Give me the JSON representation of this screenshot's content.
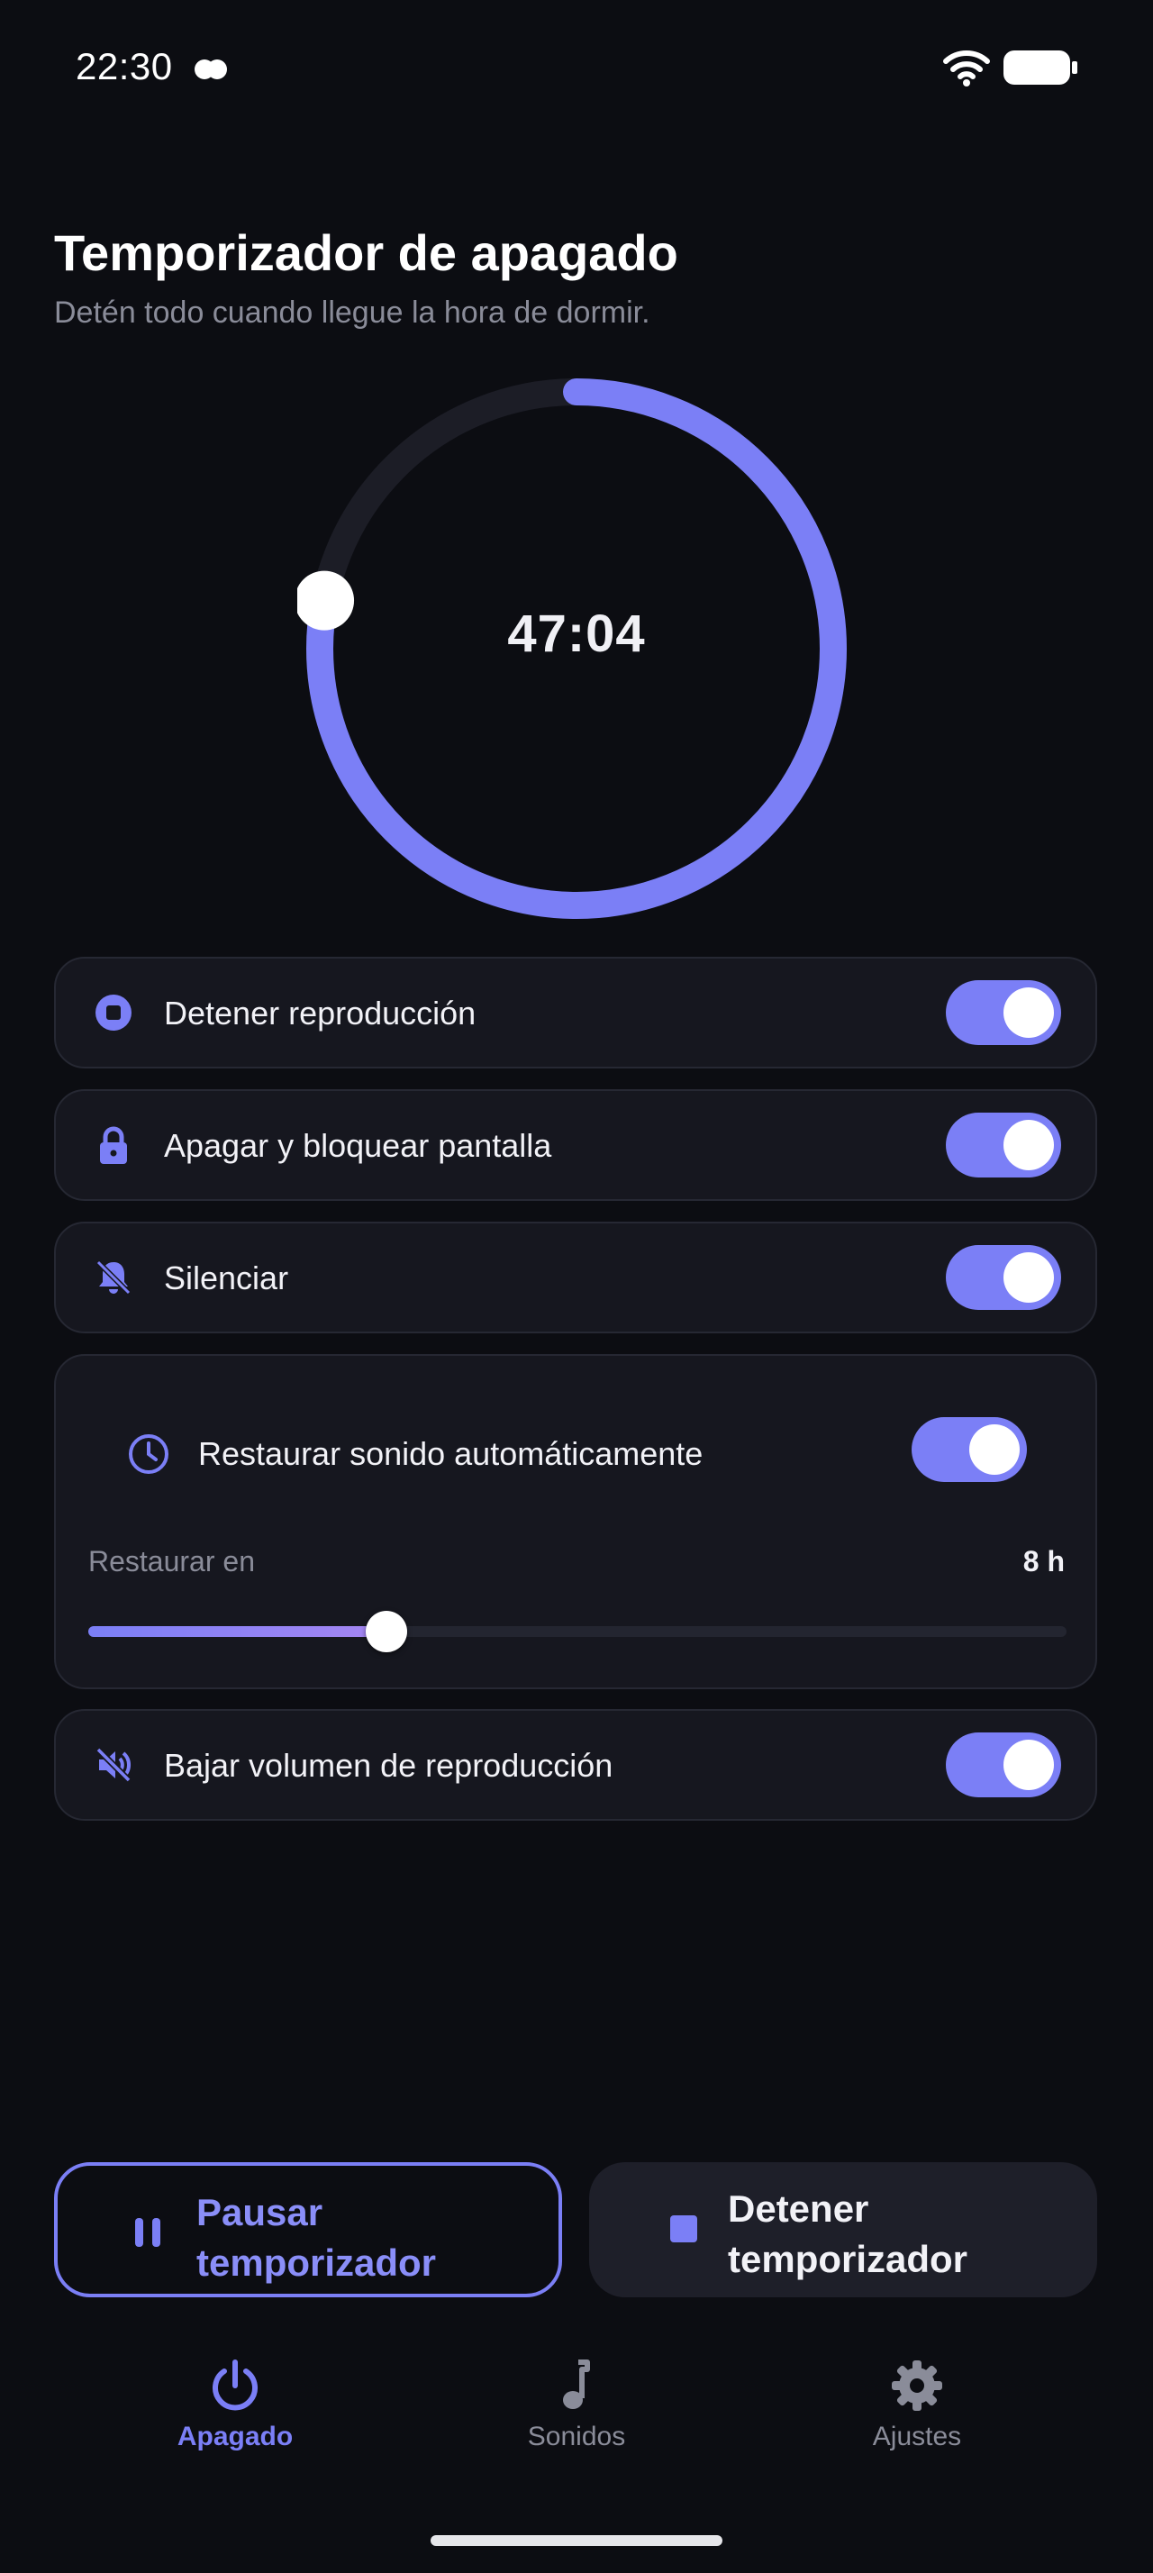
{
  "status_bar": {
    "time": "22:30"
  },
  "header": {
    "title": "Temporizador de apagado",
    "subtitle": "Detén todo cuando llegue la hora de dormir."
  },
  "timer": {
    "remaining": "47:04",
    "progress_fraction": 0.78
  },
  "options": [
    {
      "label": "Detener reproducción",
      "icon": "stop-circle-icon",
      "enabled": true
    },
    {
      "label": "Apagar y bloquear pantalla",
      "icon": "lock-icon",
      "enabled": true
    },
    {
      "label": "Silenciar",
      "icon": "bell-off-icon",
      "enabled": true
    },
    {
      "label": "Bajar volumen de reproducción",
      "icon": "volume-off-icon",
      "enabled": true
    }
  ],
  "restore": {
    "label": "Restaurar sonido automáticamente",
    "icon": "clock-icon",
    "enabled": true,
    "in_label": "Restaurar en",
    "in_value": "8 h",
    "slider_fraction": 0.305
  },
  "buttons": {
    "pause_label": "Pausar temporizador",
    "stop_label": "Detener temporizador"
  },
  "nav": [
    {
      "label": "Apagado",
      "icon": "power-icon",
      "active": true
    },
    {
      "label": "Sonidos",
      "icon": "music-note-icon",
      "active": false
    },
    {
      "label": "Ajustes",
      "icon": "gear-icon",
      "active": false
    }
  ],
  "colors": {
    "accent": "#7b7ff6",
    "background": "#0c0d12",
    "card": "#16171f",
    "muted_text": "#8a8c99"
  }
}
